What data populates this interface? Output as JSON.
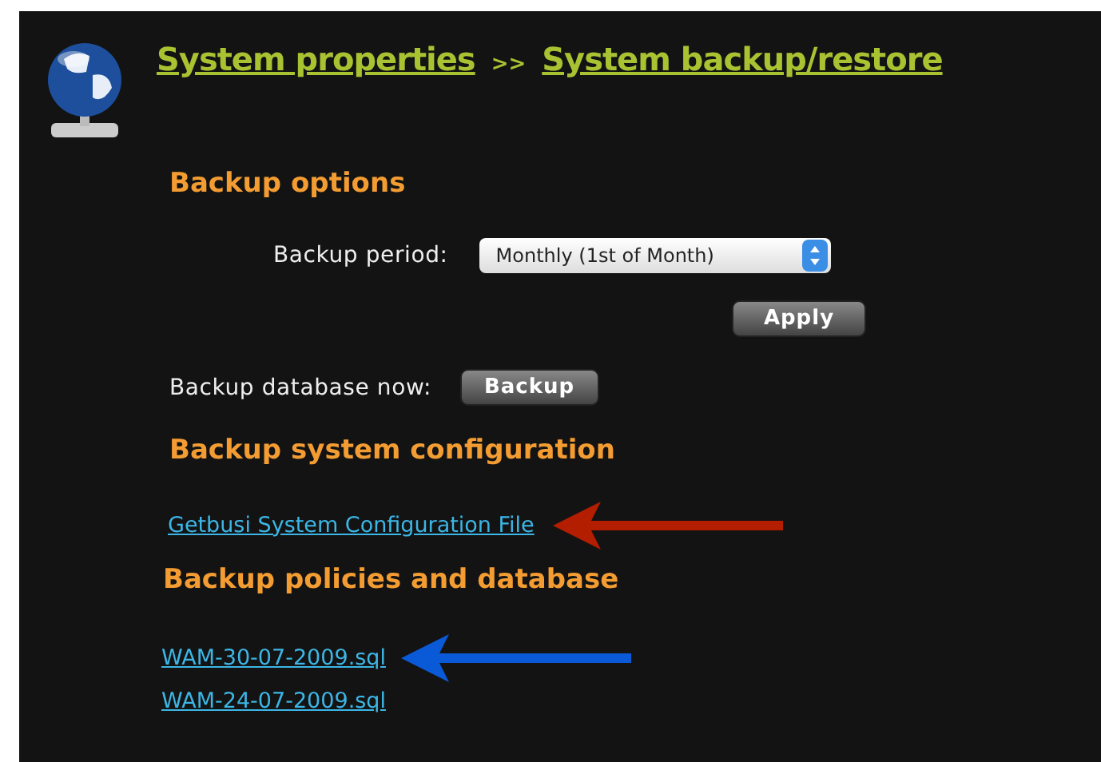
{
  "breadcrumb": {
    "items": [
      "System properties",
      "System backup/restore"
    ],
    "separator": ">>"
  },
  "backup_options": {
    "heading": "Backup options",
    "period_label": "Backup period:",
    "period_value": "Monthly (1st of Month)",
    "apply_button": "Apply",
    "now_label": "Backup database now:",
    "backup_button": "Backup"
  },
  "config_section": {
    "heading": "Backup system configuration",
    "files": [
      {
        "label": "Getbusi System Configuration File",
        "arrow": {
          "color": "#b31d00"
        }
      }
    ]
  },
  "policies_section": {
    "heading": "Backup policies and database",
    "files": [
      {
        "label": "WAM-30-07-2009.sql",
        "arrow": {
          "color": "#0a5ad8"
        }
      },
      {
        "label": "WAM-24-07-2009.sql"
      }
    ]
  }
}
